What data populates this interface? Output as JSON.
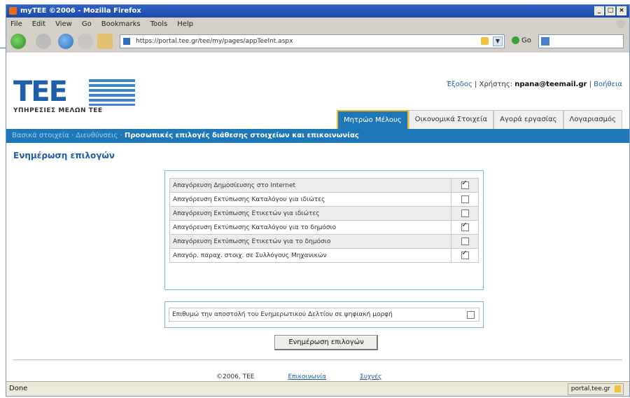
{
  "window": {
    "title": "myTEE ©2006 - Mozilla Firefox",
    "controls": [
      "_",
      "□",
      "×"
    ]
  },
  "menu": [
    "File",
    "Edit",
    "View",
    "Go",
    "Bookmarks",
    "Tools",
    "Help"
  ],
  "toolbar": {
    "url": "https://portal.tee.gr/tee/my/pages/appTeeInt.aspx",
    "go_label": "Go"
  },
  "header": {
    "logo_text": "TEE",
    "logo_sub": "ΥΠΗΡΕΣΙΕΣ ΜΕΛΩΝ ΤΕΕ",
    "logout": "Έξοδος",
    "user_label": "Χρήστης:",
    "user_email": "npana@teemail.gr",
    "help": "Βοήθεια"
  },
  "tabs": [
    {
      "label": "Μητρώο Μέλους",
      "active": true
    },
    {
      "label": "Οικονομικά Στοιχεία",
      "active": false
    },
    {
      "label": "Αγορά εργασίας",
      "active": false
    },
    {
      "label": "Λογαριασμός",
      "active": false
    }
  ],
  "breadcrumb": {
    "items": [
      "Βασικά στοιχεία",
      "Διευθύνσεις"
    ],
    "current": "Προσωπικές επιλογές διάθεσης στοιχείων και επικοινωνίας"
  },
  "section_title": "Ενημέρωση επιλογών",
  "options": [
    {
      "label": "Απαγόρευση Δημοσίευσης στο Internet",
      "checked": true
    },
    {
      "label": "Απαγόρευση Εκτύπωσης Καταλόγου για ιδιώτες",
      "checked": false
    },
    {
      "label": "Απαγόρευση Εκτύπωσης Ετικετών για ιδιώτες",
      "checked": false
    },
    {
      "label": "Απαγόρευση Εκτύπωσης Καταλόγου για το δημόσιο",
      "checked": true
    },
    {
      "label": "Απαγόρευση Εκτύπωσης Ετικετών για το δημόσιο",
      "checked": false
    },
    {
      "label": "Απαγόρ. παραχ. στοιχ. σε Συλλόγους Μηχανικών",
      "checked": true
    }
  ],
  "newsletter": {
    "label": "Επιθυμώ την αποστολή του Ενημερωτικού Δελτίου σε ψηφιακή μορφή",
    "checked": false
  },
  "update_button": "Ενημέρωση επιλογών",
  "footer": {
    "copyright": "©2006, TEE",
    "contact": "Επικοινωνία",
    "help": "Συχνές"
  },
  "status": {
    "left": "Done",
    "right": "portal.tee.gr"
  }
}
